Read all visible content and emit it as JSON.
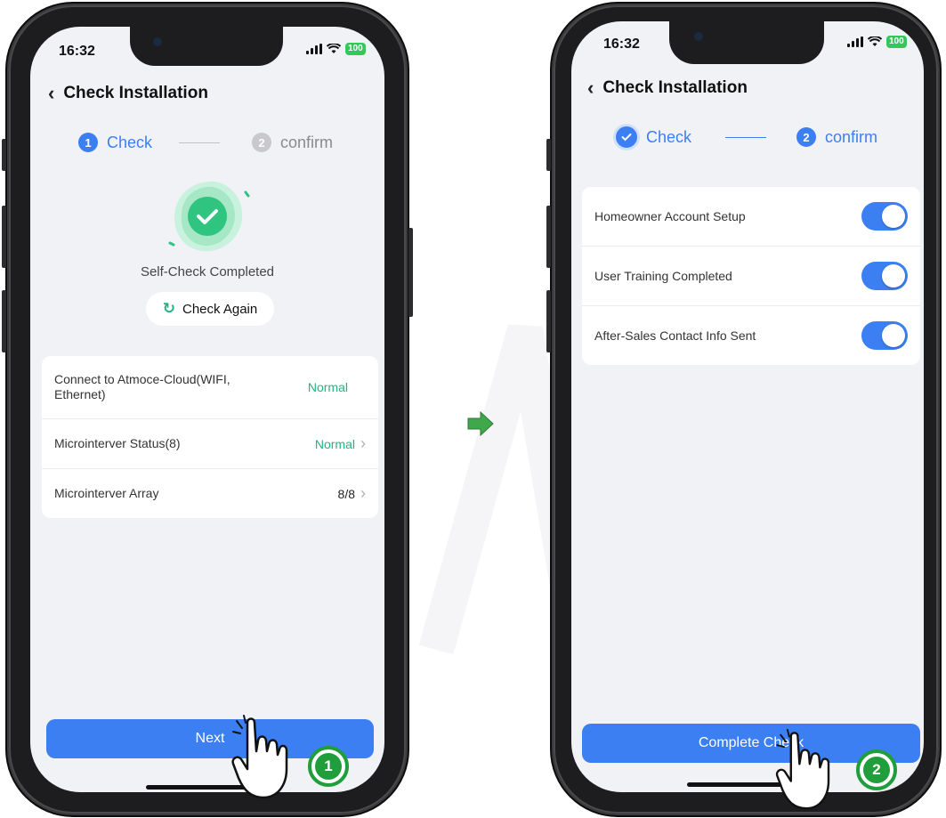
{
  "colors": {
    "accent": "#3b7ff2",
    "success": "#23b383",
    "badge": "#1f9e3b",
    "arrow": "#3fa84a"
  },
  "left_phone": {
    "status": {
      "time": "16:32",
      "battery": "100"
    },
    "header": {
      "back_icon": "chevron-left-icon",
      "title": "Check Installation"
    },
    "steps": [
      {
        "num": "1",
        "label": "Check"
      },
      {
        "num": "2",
        "label": "confirm"
      }
    ],
    "self_check": {
      "text": "Self-Check Completed",
      "check_again": "Check Again"
    },
    "rows": [
      {
        "label": "Connect to Atmoce-Cloud(WIFI, Ethernet)",
        "value": "Normal"
      },
      {
        "label": "Microinterver Status(8)",
        "value": "Normal"
      },
      {
        "label": "Microinterver Array",
        "value": "8/8"
      }
    ],
    "next_button": "Next",
    "step_badge": "1"
  },
  "right_phone": {
    "status": {
      "time": "16:32",
      "battery": "100"
    },
    "header": {
      "back_icon": "chevron-left-icon",
      "title": "Check Installation"
    },
    "steps": [
      {
        "label": "Check"
      },
      {
        "num": "2",
        "label": "confirm"
      }
    ],
    "toggles": [
      {
        "label": "Homeowner Account Setup",
        "on": true
      },
      {
        "label": "User Training Completed",
        "on": true
      },
      {
        "label": "After-Sales Contact Info Sent",
        "on": true
      }
    ],
    "complete_button": "Complete Check",
    "step_badge": "2"
  }
}
